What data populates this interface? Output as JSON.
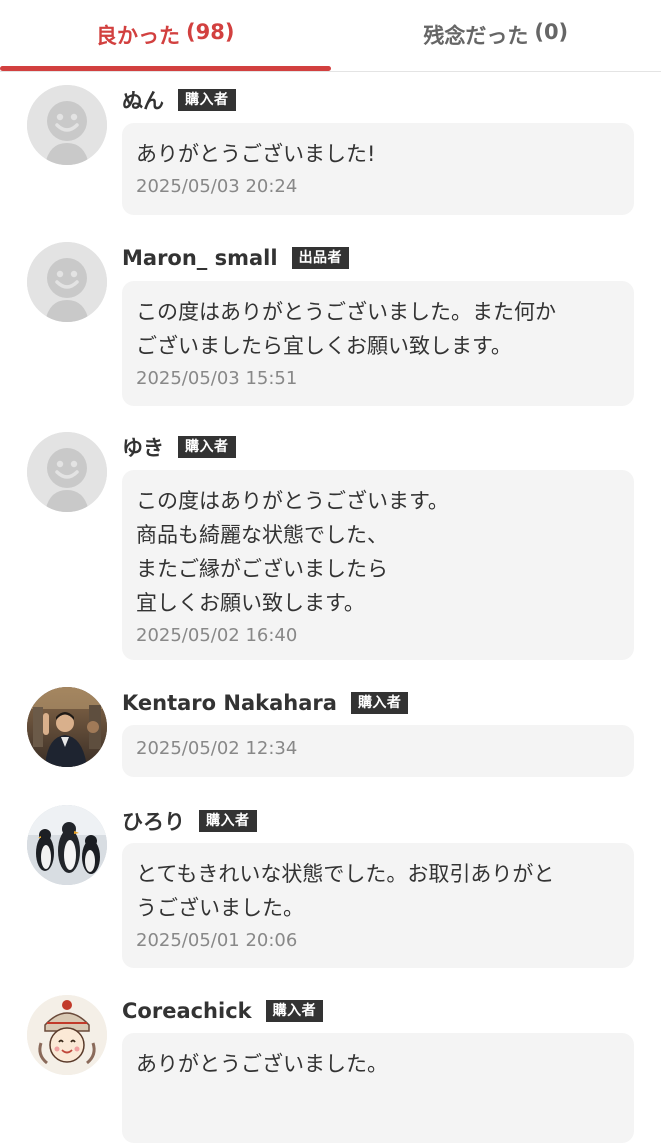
{
  "tabs": [
    {
      "label": "良かった",
      "count": "(98)",
      "active": true
    },
    {
      "label": "残念だった",
      "count": "(0)",
      "active": false
    }
  ],
  "reviews": [
    {
      "user": "ぬん",
      "badge": "購入者",
      "avatar": "default-avatar-icon",
      "comment": "ありがとうございました!",
      "date": "2025/05/03 20:24"
    },
    {
      "user": "Maron_ small",
      "badge": "出品者",
      "avatar": "default-avatar-icon",
      "comment": "この度はありがとうございました。また何か\nございましたら宜しくお願い致します。",
      "date": "2025/05/03 15:51"
    },
    {
      "user": "ゆき",
      "badge": "購入者",
      "avatar": "default-avatar-icon",
      "comment": "この度はありがとうございます。\n商品も綺麗な状態でした、\nまたご縁がございましたら\n宜しくお願い致します。",
      "date": "2025/05/02 16:40"
    },
    {
      "user": "Kentaro Nakahara",
      "badge": "購入者",
      "avatar": "photo-avatar-person",
      "comment": "",
      "date": "2025/05/02 12:34"
    },
    {
      "user": "ひろり",
      "badge": "購入者",
      "avatar": "photo-avatar-penguins",
      "comment": "とてもきれいな状態でした。お取引ありがと\nうございました。",
      "date": "2025/05/01 20:06"
    },
    {
      "user": "Coreachick",
      "badge": "購入者",
      "avatar": "illustration-avatar",
      "comment": "ありがとうございました。",
      "date": ""
    }
  ]
}
